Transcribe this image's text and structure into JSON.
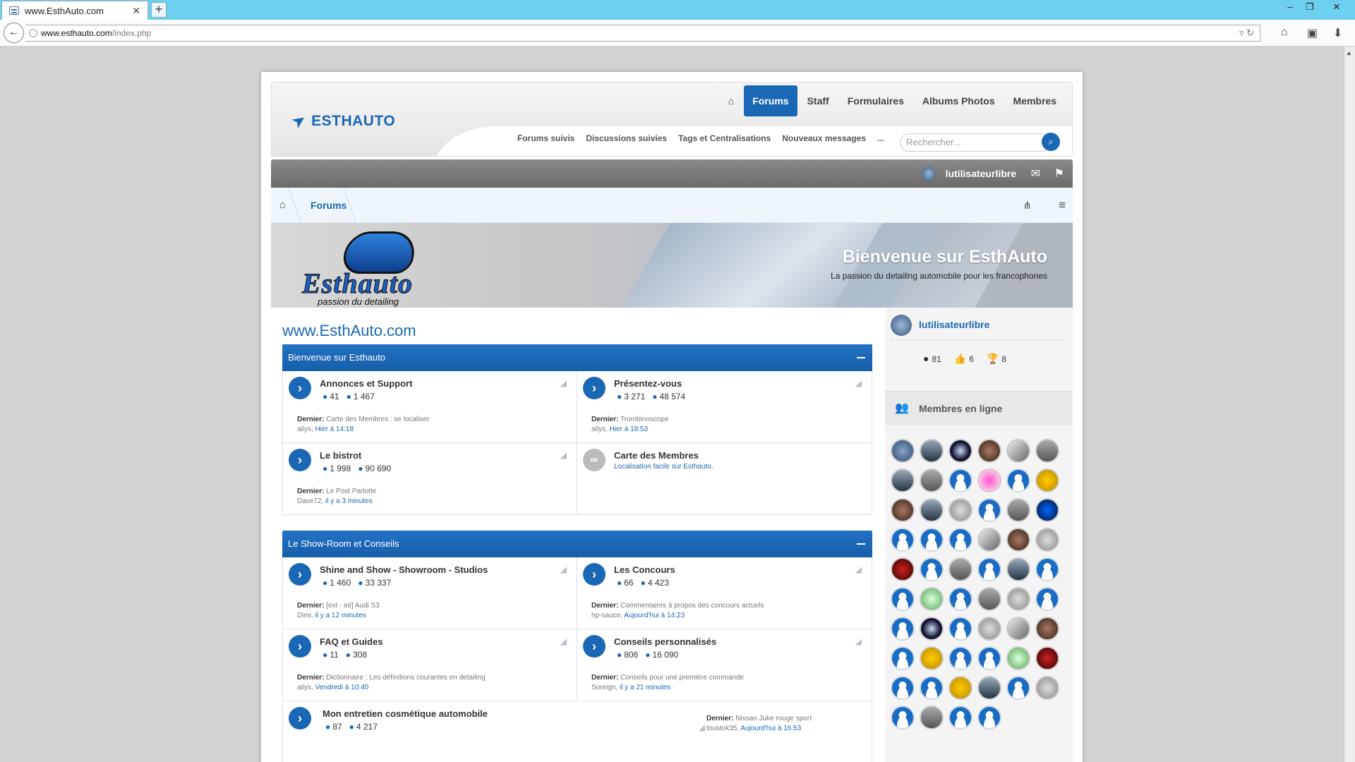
{
  "browser": {
    "tab_title": "www.EsthAuto.com",
    "url_domain": "www.esthauto.com",
    "url_path": "/index.php"
  },
  "header": {
    "logo_text": "ESTHAUTO",
    "nav": [
      {
        "label": "Forums",
        "active": true
      },
      {
        "label": "Staff"
      },
      {
        "label": "Formulaires"
      },
      {
        "label": "Albums Photos"
      },
      {
        "label": "Membres"
      }
    ],
    "subnav": [
      "Forums suivis",
      "Discussions suivies",
      "Tags et Centralisations",
      "Nouveaux messages",
      "..."
    ],
    "search_placeholder": "Rechercher..."
  },
  "userbar": {
    "username": "lutilisateurlibre"
  },
  "breadcrumb": {
    "current": "Forums"
  },
  "banner": {
    "logo_name": "Esthauto",
    "logo_tag": "passion du detailing",
    "title": "Bienvenue sur EsthAuto",
    "subtitle": "La passion du detailing automobile pour les francophones"
  },
  "main": {
    "site_title": "www.EsthAuto.com",
    "sections": [
      {
        "title": "Bienvenue sur Esthauto",
        "nodes": [
          {
            "title": "Annonces et Support",
            "threads": "41",
            "posts": "1 467",
            "last_label": "Dernier:",
            "last_title": "Carte des Membres : se localiser",
            "last_user": "ailys,",
            "last_time": "Hier à 14:18"
          },
          {
            "title": "Présentez-vous",
            "threads": "3 271",
            "posts": "48 574",
            "last_label": "Dernier:",
            "last_title": "Trombinoscope",
            "last_user": "ailys,",
            "last_time": "Hier à 18:53"
          },
          {
            "title": "Le bistrot",
            "threads": "1 998",
            "posts": "90 690",
            "last_label": "Dernier:",
            "last_title": "Le Post Parlotte",
            "last_user": "Dave72,",
            "last_time": "il y a 3 minutes"
          },
          {
            "title": "Carte des Membres",
            "desc": "Localisation facile sur Esthauto."
          }
        ]
      },
      {
        "title": "Le Show-Room et Conseils",
        "nodes": [
          {
            "title": "Shine and Show - Showroom - Studios",
            "threads": "1 460",
            "posts": "33 337",
            "last_label": "Dernier:",
            "last_title": "[ext - int] Audi S3",
            "last_user": "Dimi,",
            "last_time": "il y a 12 minutes"
          },
          {
            "title": "Les Concours",
            "threads": "66",
            "posts": "4 423",
            "last_label": "Dernier:",
            "last_title": "Commentaires à propos des concours actuels",
            "last_user": "hp-sauce,",
            "last_time": "Aujourd'hui à 14:23"
          },
          {
            "title": "FAQ et Guides",
            "threads": "11",
            "posts": "308",
            "last_label": "Dernier:",
            "last_title": "Dictionnaire : Les définitions courantes en detailing",
            "last_user": "ailys,",
            "last_time": "Vendredi à 10:40"
          },
          {
            "title": "Conseils personnalisés",
            "threads": "806",
            "posts": "16 090",
            "last_label": "Dernier:",
            "last_title": "Conseils pour une première commande",
            "last_user": "Soreign,",
            "last_time": "il y a 21 minutes"
          },
          {
            "title": "Mon entretien cosmétique automobile",
            "threads": "87",
            "posts": "4 217",
            "last_label": "Dernier:",
            "last_title": "Nissan Juke rouge sport",
            "last_user": "toustok35,",
            "last_time": "Aujourd'hui à 16:53"
          }
        ]
      }
    ]
  },
  "sidebar": {
    "username": "lutilisateurlibre",
    "messages": "81",
    "likes": "6",
    "trophies": "8",
    "online_title": "Membres en ligne"
  },
  "colors": {
    "accent": "#1a67b5",
    "tabbar": "#6cd0ee"
  }
}
